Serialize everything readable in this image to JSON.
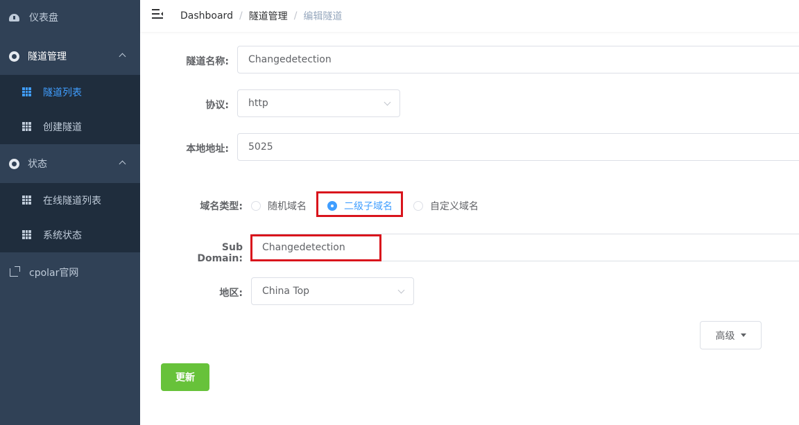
{
  "sidebar": {
    "items": [
      {
        "label": "仪表盘",
        "icon": "dashboard-icon"
      },
      {
        "label": "隧道管理",
        "icon": "tunnel-icon",
        "expanded": true,
        "children": [
          {
            "label": "隧道列表",
            "icon": "table-icon",
            "active": true
          },
          {
            "label": "创建隧道",
            "icon": "table-icon"
          }
        ]
      },
      {
        "label": "状态",
        "icon": "status-icon",
        "expanded": true,
        "children": [
          {
            "label": "在线隧道列表",
            "icon": "table-icon"
          },
          {
            "label": "系统状态",
            "icon": "table-icon"
          }
        ]
      },
      {
        "label": "cpolar官网",
        "icon": "external-link-icon"
      }
    ]
  },
  "header": {
    "breadcrumb": [
      "Dashboard",
      "隧道管理",
      "编辑隧道"
    ],
    "separator": "/"
  },
  "form": {
    "tunnel_name": {
      "label": "隧道名称:",
      "value": "Changedetection"
    },
    "protocol": {
      "label": "协议:",
      "value": "http"
    },
    "local_address": {
      "label": "本地地址:",
      "value": "5025"
    },
    "domain_type": {
      "label": "域名类型:",
      "options": [
        "随机域名",
        "二级子域名",
        "自定义域名"
      ],
      "selected": "二级子域名"
    },
    "sub_domain": {
      "label": "Sub Domain:",
      "value": "Changedetection"
    },
    "region": {
      "label": "地区:",
      "value": "China Top"
    },
    "advanced_label": "高级",
    "update_label": "更新"
  },
  "colors": {
    "sidebar_bg": "#304156",
    "submenu_bg": "#1f2d3d",
    "active": "#409eff",
    "update_button": "#67c23a",
    "highlight_box": "#d9141c"
  }
}
